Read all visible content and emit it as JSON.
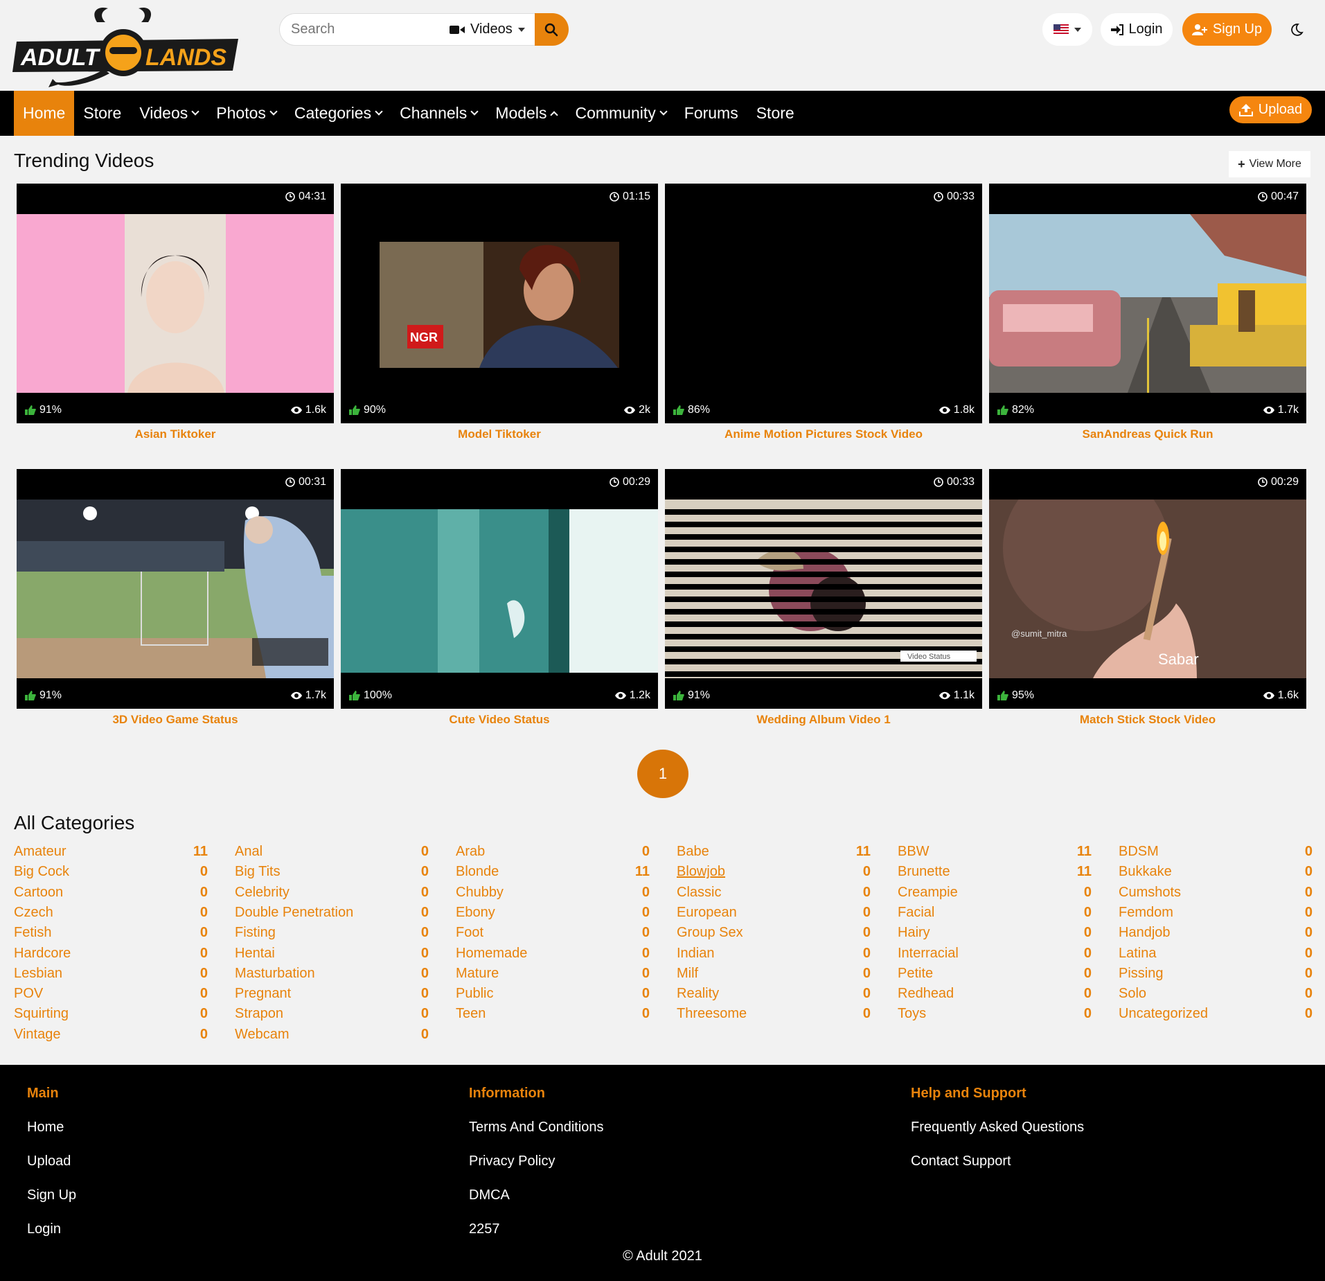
{
  "brand": {
    "logo_text_left": "ADULT",
    "logo_text_right": "LANDS",
    "accent_color": "#e8830c",
    "logo_bg": "#1a1a1a"
  },
  "search": {
    "placeholder": "Search",
    "type_selected": "Videos",
    "type_icon": "video-camera-icon",
    "button_icon": "search-icon"
  },
  "header": {
    "language_icon": "us-flag-icon",
    "login_label": "Login",
    "signup_label": "Sign Up",
    "theme_icon": "moon-icon"
  },
  "nav": {
    "items": [
      {
        "label": "Home",
        "active": true,
        "dropdown": ""
      },
      {
        "label": "Store",
        "active": false,
        "dropdown": ""
      },
      {
        "label": "Videos",
        "active": false,
        "dropdown": "down"
      },
      {
        "label": "Photos",
        "active": false,
        "dropdown": "down"
      },
      {
        "label": "Categories",
        "active": false,
        "dropdown": "down"
      },
      {
        "label": "Channels",
        "active": false,
        "dropdown": "down"
      },
      {
        "label": "Models",
        "active": false,
        "dropdown": "up"
      },
      {
        "label": "Community",
        "active": false,
        "dropdown": "down"
      },
      {
        "label": "Forums",
        "active": false,
        "dropdown": ""
      },
      {
        "label": "Store",
        "active": false,
        "dropdown": ""
      }
    ],
    "upload_label": "Upload"
  },
  "trending": {
    "title": "Trending Videos",
    "view_more_label": "View More",
    "videos": [
      {
        "title": "Asian Tiktoker",
        "duration": "04:31",
        "rating": "91%",
        "views": "1.6k"
      },
      {
        "title": "Model Tiktoker",
        "duration": "01:15",
        "rating": "90%",
        "views": "2k"
      },
      {
        "title": "Anime Motion Pictures Stock Video",
        "duration": "00:33",
        "rating": "86%",
        "views": "1.8k"
      },
      {
        "title": "SanAndreas Quick Run",
        "duration": "00:47",
        "rating": "82%",
        "views": "1.7k"
      },
      {
        "title": "3D Video Game Status",
        "duration": "00:31",
        "rating": "91%",
        "views": "1.7k"
      },
      {
        "title": "Cute Video Status",
        "duration": "00:29",
        "rating": "100%",
        "views": "1.2k"
      },
      {
        "title": "Wedding Album Video 1",
        "duration": "00:33",
        "rating": "91%",
        "views": "1.1k"
      },
      {
        "title": "Match Stick Stock Video",
        "duration": "00:29",
        "rating": "95%",
        "views": "1.6k"
      }
    ],
    "thumb_overlays": {
      "ngr_watermark": "NGR",
      "sumit_handle": "@sumit_mitra",
      "sabar_caption": "Sabar",
      "video_status_badge": "Video Status"
    }
  },
  "pagination": {
    "current": "1"
  },
  "categories": {
    "title": "All Categories",
    "items": [
      {
        "name": "Amateur",
        "count": "11"
      },
      {
        "name": "Anal",
        "count": "0"
      },
      {
        "name": "Arab",
        "count": "0"
      },
      {
        "name": "Babe",
        "count": "11"
      },
      {
        "name": "BBW",
        "count": "11"
      },
      {
        "name": "BDSM",
        "count": "0"
      },
      {
        "name": "Big Cock",
        "count": "0"
      },
      {
        "name": "Big Tits",
        "count": "0"
      },
      {
        "name": "Blonde",
        "count": "11"
      },
      {
        "name": "Blowjob",
        "count": "0"
      },
      {
        "name": "Brunette",
        "count": "11"
      },
      {
        "name": "Bukkake",
        "count": "0"
      },
      {
        "name": "Cartoon",
        "count": "0"
      },
      {
        "name": "Celebrity",
        "count": "0"
      },
      {
        "name": "Chubby",
        "count": "0"
      },
      {
        "name": "Classic",
        "count": "0"
      },
      {
        "name": "Creampie",
        "count": "0"
      },
      {
        "name": "Cumshots",
        "count": "0"
      },
      {
        "name": "Czech",
        "count": "0"
      },
      {
        "name": "Double Penetration",
        "count": "0"
      },
      {
        "name": "Ebony",
        "count": "0"
      },
      {
        "name": "European",
        "count": "0"
      },
      {
        "name": "Facial",
        "count": "0"
      },
      {
        "name": "Femdom",
        "count": "0"
      },
      {
        "name": "Fetish",
        "count": "0"
      },
      {
        "name": "Fisting",
        "count": "0"
      },
      {
        "name": "Foot",
        "count": "0"
      },
      {
        "name": "Group Sex",
        "count": "0"
      },
      {
        "name": "Hairy",
        "count": "0"
      },
      {
        "name": "Handjob",
        "count": "0"
      },
      {
        "name": "Hardcore",
        "count": "0"
      },
      {
        "name": "Hentai",
        "count": "0"
      },
      {
        "name": "Homemade",
        "count": "0"
      },
      {
        "name": "Indian",
        "count": "0"
      },
      {
        "name": "Interracial",
        "count": "0"
      },
      {
        "name": "Latina",
        "count": "0"
      },
      {
        "name": "Lesbian",
        "count": "0"
      },
      {
        "name": "Masturbation",
        "count": "0"
      },
      {
        "name": "Mature",
        "count": "0"
      },
      {
        "name": "Milf",
        "count": "0"
      },
      {
        "name": "Petite",
        "count": "0"
      },
      {
        "name": "Pissing",
        "count": "0"
      },
      {
        "name": "POV",
        "count": "0"
      },
      {
        "name": "Pregnant",
        "count": "0"
      },
      {
        "name": "Public",
        "count": "0"
      },
      {
        "name": "Reality",
        "count": "0"
      },
      {
        "name": "Redhead",
        "count": "0"
      },
      {
        "name": "Solo",
        "count": "0"
      },
      {
        "name": "Squirting",
        "count": "0"
      },
      {
        "name": "Strapon",
        "count": "0"
      },
      {
        "name": "Teen",
        "count": "0"
      },
      {
        "name": "Threesome",
        "count": "0"
      },
      {
        "name": "Toys",
        "count": "0"
      },
      {
        "name": "Uncategorized",
        "count": "0"
      },
      {
        "name": "Vintage",
        "count": "0"
      },
      {
        "name": "Webcam",
        "count": "0"
      }
    ]
  },
  "footer": {
    "main": {
      "heading": "Main",
      "links": [
        "Home",
        "Upload",
        "Sign Up",
        "Login"
      ]
    },
    "information": {
      "heading": "Information",
      "links": [
        "Terms And Conditions",
        "Privacy Policy",
        "DMCA",
        "2257"
      ]
    },
    "help": {
      "heading": "Help and Support",
      "links": [
        "Frequently Asked Questions",
        "Contact Support"
      ]
    },
    "copyright": "© Adult 2021"
  }
}
